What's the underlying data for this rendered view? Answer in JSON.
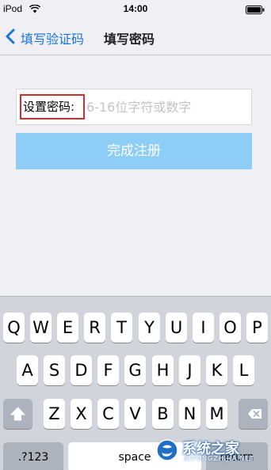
{
  "status_bar": {
    "carrier": "iPod",
    "time": "14:00",
    "wifi_icon": "wifi-icon",
    "battery_icon": "battery-icon"
  },
  "nav": {
    "back_label": "填写验证码",
    "title": "填写密码",
    "back_icon": "chevron-left-icon",
    "accent_color": "#1a74d9"
  },
  "form": {
    "password_label": "设置密码:",
    "password_value": "",
    "password_placeholder": "6-16位字符或数字",
    "register_label": "完成注册",
    "register_color": "#8ecdf6",
    "highlight_color": "#d92b2b"
  },
  "keyboard": {
    "row1": [
      "Q",
      "W",
      "E",
      "R",
      "T",
      "Y",
      "U",
      "I",
      "O",
      "P"
    ],
    "row2": [
      "A",
      "S",
      "D",
      "F",
      "G",
      "H",
      "J",
      "K",
      "L"
    ],
    "row3": [
      "Z",
      "X",
      "C",
      "V",
      "B",
      "N",
      "M"
    ],
    "shift_icon": "shift-icon",
    "delete_icon": "delete-icon",
    "numbers_label": ".?123",
    "space_label": "space",
    "return_label": "return"
  },
  "watermark": {
    "text": "系统之家",
    "subtext": "XITONGZHIJIA.NET",
    "logo_icon": "watermark-logo-icon"
  }
}
